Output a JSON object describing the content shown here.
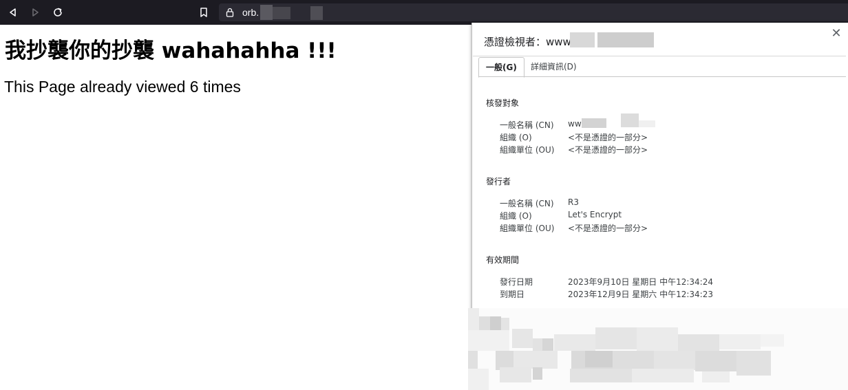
{
  "browser": {
    "url_prefix": "orb."
  },
  "page": {
    "heading": "我抄襲你的抄襲 wahahahha !!!",
    "views_text": "This Page already viewed 6 times"
  },
  "cert_viewer": {
    "title": "憑證檢視者：www.",
    "close_glyph": "✕",
    "tabs": [
      {
        "label": "一般(G)"
      },
      {
        "label": "詳細資訊(D)"
      }
    ],
    "subject": {
      "title": "核發對象",
      "rows": [
        {
          "label": "一般名稱 (CN)",
          "value": "ww"
        },
        {
          "label": "組織 (O)",
          "value": "<不是憑證的一部分>"
        },
        {
          "label": "組織單位 (OU)",
          "value": "<不是憑證的一部分>"
        }
      ]
    },
    "issuer": {
      "title": "發行者",
      "rows": [
        {
          "label": "一般名稱 (CN)",
          "value": "R3"
        },
        {
          "label": "組織 (O)",
          "value": "Let's Encrypt"
        },
        {
          "label": "組織單位 (OU)",
          "value": "<不是憑證的一部分>"
        }
      ]
    },
    "validity": {
      "title": "有效期間",
      "rows": [
        {
          "label": "發行日期",
          "value": "2023年9月10日 星期日 中午12:34:24"
        },
        {
          "label": "到期日",
          "value": "2023年12月9日 星期六 中午12:34:23"
        }
      ]
    }
  },
  "colors": {
    "toolbar_bg": "#1c1b22",
    "urlbar_bg": "#2b2a33",
    "redaction_gray": "#cfcfcf"
  }
}
